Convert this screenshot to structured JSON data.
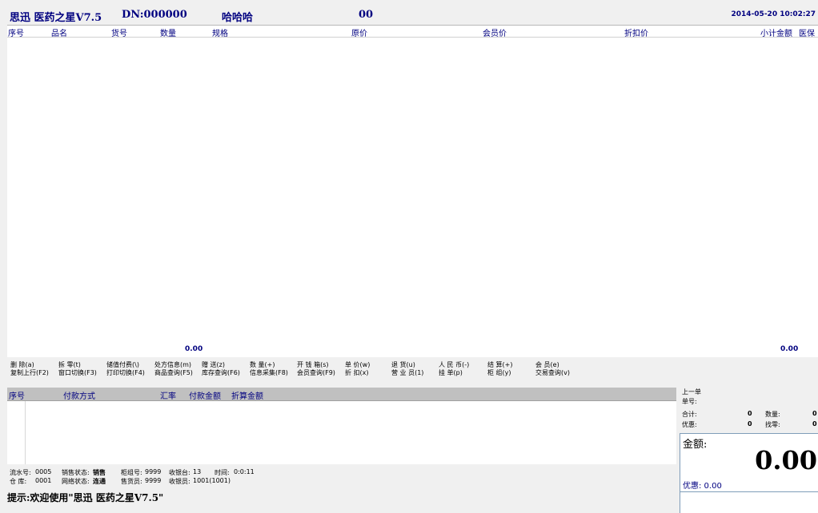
{
  "header": {
    "app_title": "思迅 医药之星V7.5",
    "dn": "DN:000000",
    "user": "哈哈哈",
    "code": "00",
    "datetime": "2014-05-20 10:02:27"
  },
  "product_table": {
    "columns": [
      "序号",
      "品名",
      "货号",
      "数量",
      "规格",
      "原价",
      "会员价",
      "折扣价",
      "小计金额",
      "医保"
    ],
    "total_qty": "0.00",
    "total_amount": "0.00"
  },
  "shortcuts": {
    "row1": [
      "删  除(a)",
      "拆  零(t)",
      "储值付费(\\)",
      "处方信息(m)",
      "赠  送(z)",
      "数  量(+)",
      "开 钱 箱(s)",
      "单  价(w)",
      "退  货(u)",
      "人 民 币(-)",
      "结  算(+)",
      "会  员(e)"
    ],
    "row2": [
      "复制上行(F2)",
      "窗口切换(F3)",
      "打印切换(F4)",
      "商品查询(F5)",
      "库存查询(F6)",
      "信息采集(F8)",
      "会员查询(F9)",
      "折  扣(x)",
      "营 业 员(1)",
      "挂  单(p)",
      "柜  组(y)",
      "交易查询(v)"
    ]
  },
  "payment_table": {
    "columns": [
      "序号",
      "付款方式",
      "汇率",
      "付款金额",
      "折算金额"
    ]
  },
  "status": {
    "serial_label": "流水号:",
    "serial": "0005",
    "sale_state_label": "销售状态:",
    "sale_state": "销售",
    "counter_label": "柜组号:",
    "counter": "9999",
    "register_label": "收银台:",
    "register": "13",
    "time_label": "时间:",
    "time": "0:0:11",
    "warehouse_label": "仓  库:",
    "warehouse": "0001",
    "net_state_label": "网络状态:",
    "net_state": "连通",
    "seller_label": "售货员:",
    "seller": "9999",
    "cashier_label": "收银员:",
    "cashier": "1001(1001)",
    "tip": "提示:欢迎使用\"思迅 医药之星V7.5\""
  },
  "previous_order": {
    "title": "上一单",
    "order_no_label": "单号:",
    "total_label": "合计:",
    "total": "0",
    "qty_label": "数量:",
    "qty": "0",
    "discount_label": "优惠:",
    "discount": "0",
    "change_label": "找零:",
    "change": "0"
  },
  "amount": {
    "label": "金额:",
    "value": "0.00",
    "discount_line": "优惠: 0.00"
  }
}
